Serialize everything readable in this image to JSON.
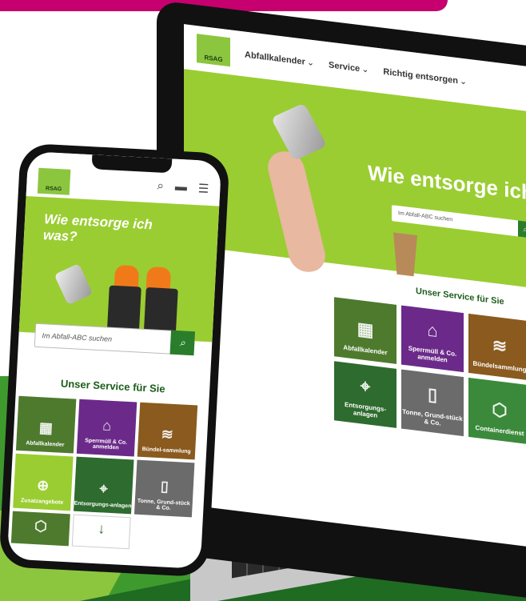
{
  "laptop": {
    "nav": {
      "logo": "RSAG",
      "items": [
        "Abfallkalender",
        "Service",
        "Richtig entsorgen"
      ],
      "chevron": "⌄"
    },
    "hero": {
      "title": "Wie entsorge ich was",
      "search_placeholder": "Im Abfall-ABC suchen",
      "search_icon": "magnifier-icon"
    },
    "service": {
      "title": "Unser Service für Sie",
      "tiles": [
        {
          "label": "Abfallkalender",
          "icon": "calendar-icon"
        },
        {
          "label": "Sperrmüll & Co. anmelden",
          "icon": "furniture-icon"
        },
        {
          "label": "Bündelsammlung",
          "icon": "bundle-icon"
        },
        {
          "label": "Entsorgungs-anlagen",
          "icon": "location-building-icon"
        },
        {
          "label": "Tonne, Grund-stück & Co.",
          "icon": "bin-icon"
        },
        {
          "label": "Containerdienst",
          "icon": "container-icon"
        }
      ]
    }
  },
  "phone": {
    "logo": "RSAG",
    "icons": [
      "search-icon",
      "chat-icon",
      "menu-icon"
    ],
    "hero": {
      "title": "Wie entsorge ich was?",
      "search_placeholder": "Im Abfall-ABC suchen"
    },
    "service": {
      "title": "Unser Service für Sie",
      "tiles": [
        {
          "label": "Abfallkalender",
          "icon": "calendar-icon"
        },
        {
          "label": "Sperrmüll & Co. anmelden",
          "icon": "furniture-icon"
        },
        {
          "label": "Bündel-sammlung",
          "icon": "bundle-icon"
        },
        {
          "label": "Zusatzangebote",
          "icon": "plus-circle-icon"
        },
        {
          "label": "Entsorgungs-anlagen",
          "icon": "location-building-icon"
        },
        {
          "label": "Tonne, Grund-stück & Co.",
          "icon": "bin-icon"
        }
      ]
    }
  }
}
